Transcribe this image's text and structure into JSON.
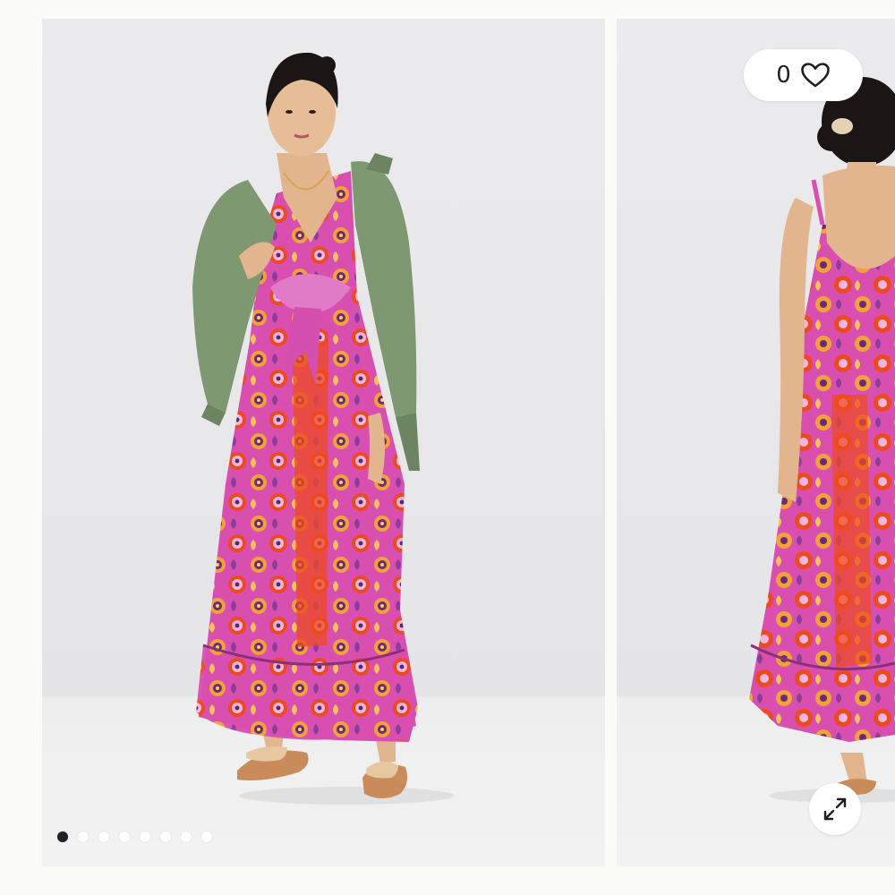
{
  "gallery": {
    "slides": [
      {
        "name": "product-photo-front",
        "kind": "model-front-view"
      },
      {
        "name": "product-photo-back",
        "kind": "model-back-view"
      }
    ],
    "wishlist": {
      "count": "0",
      "icon": "heart-icon"
    },
    "pagination": {
      "total": 8,
      "active_index": 0
    },
    "expand": {
      "icon": "expand-arrows-icon"
    },
    "colors": {
      "background": "#fbfbf7",
      "dress_pink": "#d84fb0",
      "dress_orange": "#ee4a1f",
      "jacket_green": "#7e9872",
      "dot_active": "#1e2228",
      "dot_inactive": "#ffffff"
    }
  }
}
